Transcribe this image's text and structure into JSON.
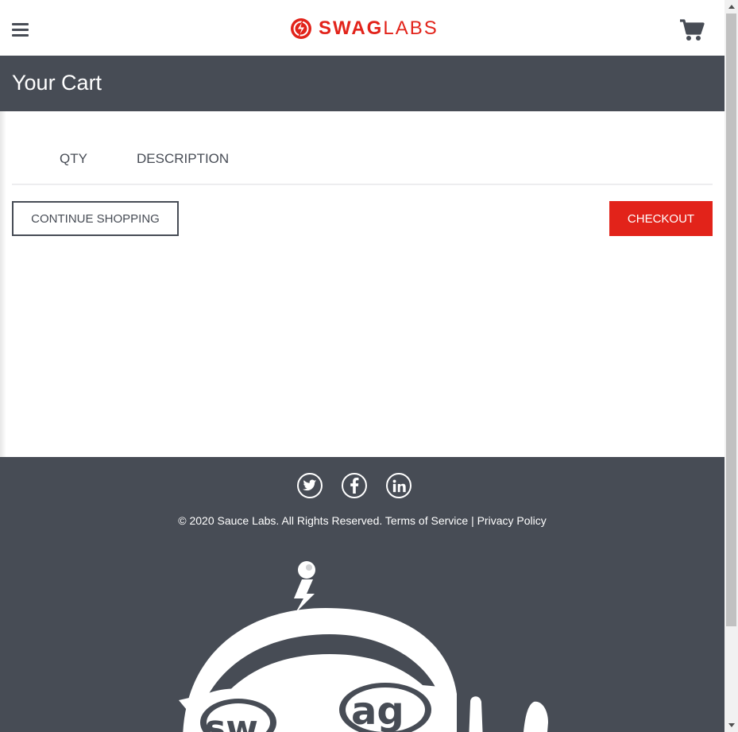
{
  "header": {
    "menu_icon": "hamburger-menu-icon",
    "logo": {
      "bold": "SWAG",
      "light": "LABS",
      "color": "#e2231a"
    },
    "cart_icon": "shopping-cart-icon"
  },
  "subheader": {
    "title": "Your Cart"
  },
  "cart_list": {
    "columns": {
      "qty": "QTY",
      "description": "DESCRIPTION"
    }
  },
  "actions": {
    "continue_label": "CONTINUE SHOPPING",
    "checkout_label": "CHECKOUT"
  },
  "footer": {
    "social": [
      "twitter-icon",
      "facebook-icon",
      "linkedin-icon"
    ],
    "copy_text": "© 2020 Sauce Labs. All Rights Reserved.",
    "terms_label": "Terms of Service",
    "separator": "|",
    "privacy_label": "Privacy Policy"
  },
  "colors": {
    "accent": "#e2231a",
    "dark": "#474c55",
    "divider": "#ededef"
  }
}
